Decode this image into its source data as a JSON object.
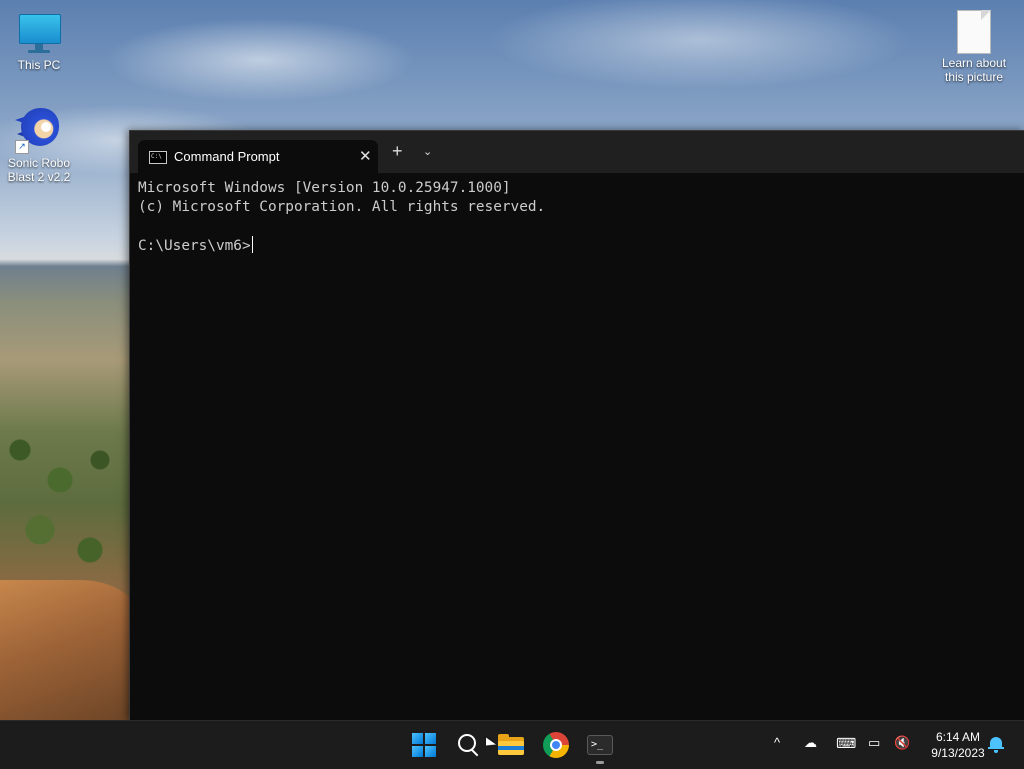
{
  "desktop": {
    "icons": [
      {
        "label": "This PC",
        "icon": "monitor-icon"
      },
      {
        "label": "Sonic Robo Blast 2 v2.2",
        "icon": "sonic-game-icon"
      },
      {
        "label": "Learn about this picture",
        "icon": "document-icon"
      }
    ]
  },
  "terminal": {
    "tab_title": "Command Prompt",
    "tab_icon_text": "C:\\",
    "close_symbol": "✕",
    "new_tab_symbol": "+",
    "dropdown_symbol": "⌄",
    "lines": [
      "Microsoft Windows [Version 10.0.25947.1000]",
      "(c) Microsoft Corporation. All rights reserved.",
      "",
      "C:\\Users\\vm6>"
    ],
    "background_color": "#0c0c0c",
    "text_color": "#cccccc"
  },
  "taskbar": {
    "apps": [
      {
        "name": "Start",
        "icon": "windows-logo-icon"
      },
      {
        "name": "Search",
        "icon": "search-icon"
      },
      {
        "name": "File Explorer",
        "icon": "folder-icon"
      },
      {
        "name": "Google Chrome",
        "icon": "chrome-icon"
      },
      {
        "name": "Terminal",
        "icon": "terminal-icon",
        "active": true
      }
    ],
    "tray": {
      "chevron_symbol": "^",
      "time": "6:14 AM",
      "date": "9/13/2023"
    }
  }
}
